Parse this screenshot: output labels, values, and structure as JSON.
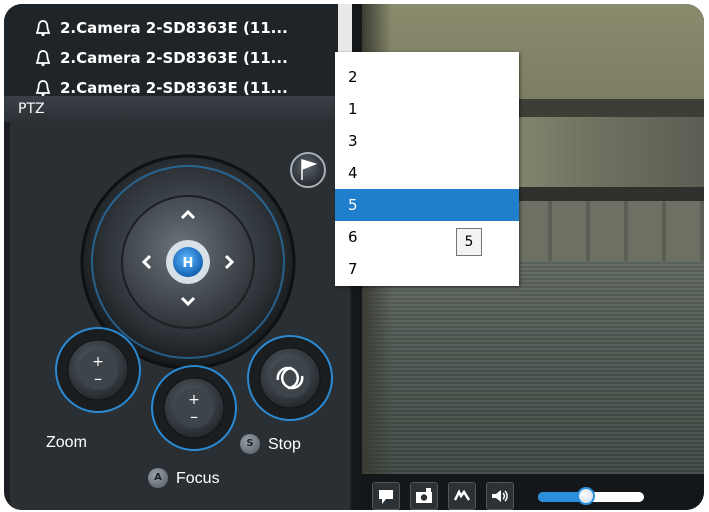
{
  "camera_list": {
    "items": [
      {
        "label": "2.Camera 2-SD8363E (11..."
      },
      {
        "label": "2.Camera 2-SD8363E (11..."
      },
      {
        "label": "2.Camera 2-SD8363E (11..."
      }
    ]
  },
  "ptz": {
    "title": "PTZ",
    "zoom_label": "Zoom",
    "focus_label": "Focus",
    "stop_label": "Stop",
    "home_label": "H",
    "focus_shortcut": "A",
    "stop_shortcut": "S"
  },
  "preset_dropdown": {
    "options": [
      "2",
      "1",
      "3",
      "4",
      "5",
      "6",
      "7"
    ],
    "selected": "5",
    "tooltip": "5"
  },
  "toolbar": {
    "volume_level": 0.45
  },
  "colors": {
    "accent": "#2a8fdc",
    "selected_row": "#1f7fcc",
    "panel_bg": "#2a2f33"
  }
}
